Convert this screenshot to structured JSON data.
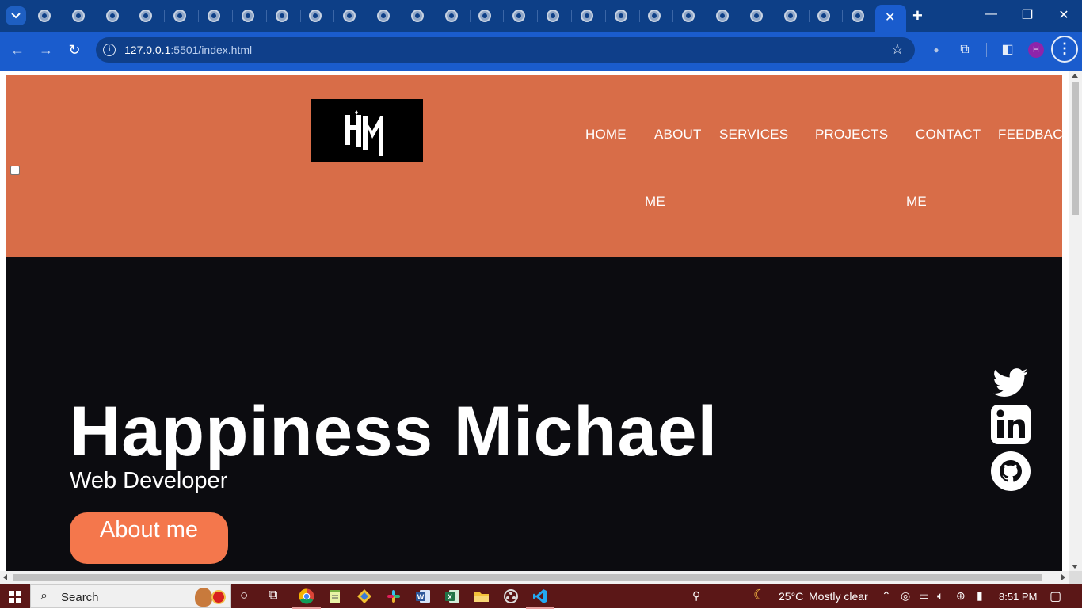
{
  "browser": {
    "tabs_count": 25,
    "active_tab_close": "✕",
    "new_tab": "+",
    "url_host": "127.0.0.1",
    "url_rest": ":5501/index.html",
    "profile_initial": "H",
    "controls": {
      "minimize": "—",
      "restore": "❐",
      "close": "✕"
    }
  },
  "site": {
    "nav": [
      {
        "label": "HOME"
      },
      {
        "label": "ABOUT",
        "label2": "ME"
      },
      {
        "label": "SERVICES"
      },
      {
        "label": "PROJECTS"
      },
      {
        "label": "CONTACT",
        "label2": "ME"
      },
      {
        "label": "FEEDBACK"
      }
    ],
    "logo_text": "HM",
    "hero": {
      "name": "Happiness Michael",
      "role": "Web Developer",
      "cta": "About me"
    },
    "socials": [
      "twitter-icon",
      "linkedin-icon",
      "github-icon"
    ]
  },
  "taskbar": {
    "search_label": "Search",
    "weather_temp": "25°C",
    "weather_desc": "Mostly clear",
    "time": "8:51 PM"
  },
  "colors": {
    "header_bg": "#d86d48",
    "hero_bg": "#0c0c10",
    "cta_bg": "#f4774c",
    "chrome_dark": "#0d3f87",
    "chrome_light": "#1a5ccd",
    "taskbar_bg": "#5b1717"
  }
}
